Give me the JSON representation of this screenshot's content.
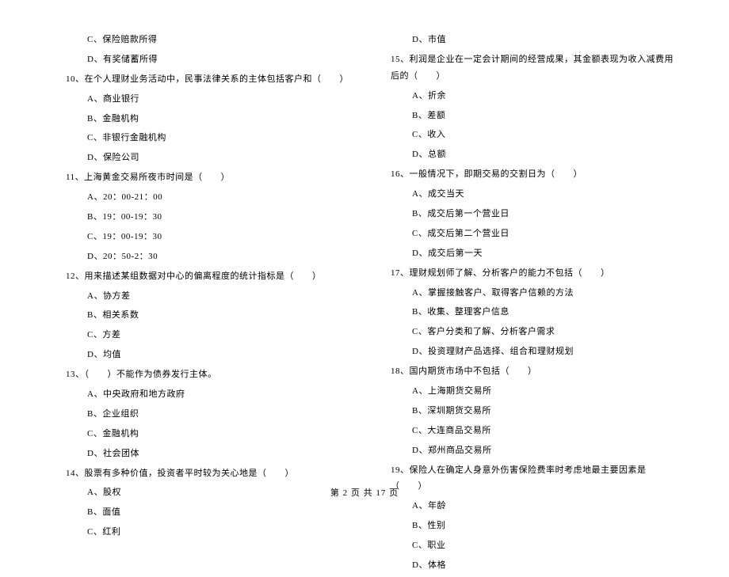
{
  "left_column": [
    {
      "type": "option",
      "text": "C、保险赔款所得"
    },
    {
      "type": "option",
      "text": "D、有奖储蓄所得"
    },
    {
      "type": "stem",
      "text": "10、在个人理财业务活动中，民事法律关系的主体包括客户和（　　）"
    },
    {
      "type": "option",
      "text": "A、商业银行"
    },
    {
      "type": "option",
      "text": "B、金融机构"
    },
    {
      "type": "option",
      "text": "C、非银行金融机构"
    },
    {
      "type": "option",
      "text": "D、保险公司"
    },
    {
      "type": "stem",
      "text": "11、上海黄金交易所夜市时间是（　　）"
    },
    {
      "type": "option",
      "text": "A、20：00-21：00"
    },
    {
      "type": "option",
      "text": "B、19：00-19：30"
    },
    {
      "type": "option",
      "text": "C、19：00-19：30"
    },
    {
      "type": "option",
      "text": "D、20：50-2：30"
    },
    {
      "type": "stem",
      "text": "12、用来描述某组数据对中心的偏离程度的统计指标是（　　）"
    },
    {
      "type": "option",
      "text": "A、协方差"
    },
    {
      "type": "option",
      "text": "B、相关系数"
    },
    {
      "type": "option",
      "text": "C、方差"
    },
    {
      "type": "option",
      "text": "D、均值"
    },
    {
      "type": "stem",
      "text": "13、（　　）不能作为债券发行主体。"
    },
    {
      "type": "option",
      "text": "A、中央政府和地方政府"
    },
    {
      "type": "option",
      "text": "B、企业组织"
    },
    {
      "type": "option",
      "text": "C、金融机构"
    },
    {
      "type": "option",
      "text": "D、社会团体"
    },
    {
      "type": "stem",
      "text": "14、股票有多种价值，投资者平时较为关心地是（　　）"
    },
    {
      "type": "option",
      "text": "A、股权"
    },
    {
      "type": "option",
      "text": "B、面值"
    },
    {
      "type": "option",
      "text": "C、红利"
    }
  ],
  "right_column": [
    {
      "type": "option",
      "text": "D、市值"
    },
    {
      "type": "stem",
      "text": "15、利润是企业在一定会计期间的经营成果，其金额表现为收入减费用后的（　　）"
    },
    {
      "type": "option",
      "text": "A、折余"
    },
    {
      "type": "option",
      "text": "B、差额"
    },
    {
      "type": "option",
      "text": "C、收入"
    },
    {
      "type": "option",
      "text": "D、总额"
    },
    {
      "type": "stem",
      "text": "16、一般情况下，即期交易的交割日为（　　）"
    },
    {
      "type": "option",
      "text": "A、成交当天"
    },
    {
      "type": "option",
      "text": "B、成交后第一个营业日"
    },
    {
      "type": "option",
      "text": "C、成交后第二个营业日"
    },
    {
      "type": "option",
      "text": "D、成交后第一天"
    },
    {
      "type": "stem",
      "text": "17、理财规划师了解、分析客户的能力不包括（　　）"
    },
    {
      "type": "option",
      "text": "A、掌握接触客户、取得客户信赖的方法"
    },
    {
      "type": "option",
      "text": "B、收集、整理客户信息"
    },
    {
      "type": "option",
      "text": "C、客户分类和了解、分析客户需求"
    },
    {
      "type": "option",
      "text": "D、投资理财产品选择、组合和理财规划"
    },
    {
      "type": "stem",
      "text": "18、国内期货市场中不包括（　　）"
    },
    {
      "type": "option",
      "text": "A、上海期货交易所"
    },
    {
      "type": "option",
      "text": "B、深圳期货交易所"
    },
    {
      "type": "option",
      "text": "C、大连商品交易所"
    },
    {
      "type": "option",
      "text": "D、郑州商品交易所"
    },
    {
      "type": "stem",
      "text": "19、保险人在确定人身意外伤害保险费率时考虑地最主要因素是（　　）"
    },
    {
      "type": "option",
      "text": "A、年龄"
    },
    {
      "type": "option",
      "text": "B、性别"
    },
    {
      "type": "option",
      "text": "C、职业"
    },
    {
      "type": "option",
      "text": "D、体格"
    }
  ],
  "footer": "第 2 页 共 17 页"
}
